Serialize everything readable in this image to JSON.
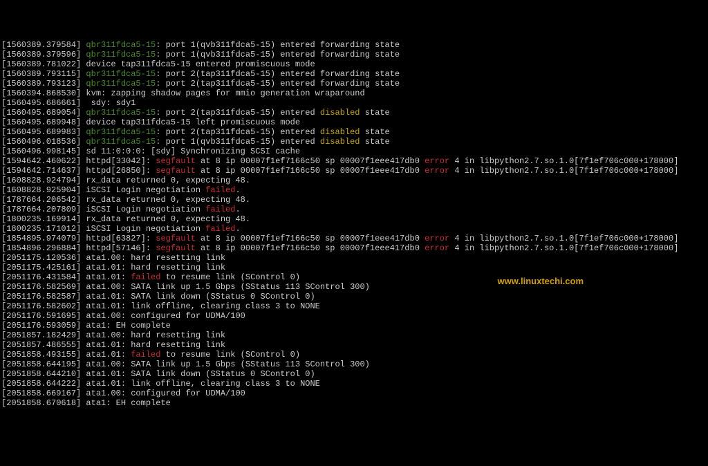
{
  "watermark": "www.linuxtechi.com",
  "lines": [
    {
      "ts": "[1560389.379584]",
      "parts": [
        {
          "c": "green",
          "t": " qbr311fdca5-15"
        },
        {
          "c": "txt",
          "t": ": port 1(qvb311fdca5-15) entered forwarding state"
        }
      ]
    },
    {
      "ts": "[1560389.379596]",
      "parts": [
        {
          "c": "green",
          "t": " qbr311fdca5-15"
        },
        {
          "c": "txt",
          "t": ": port 1(qvb311fdca5-15) entered forwarding state"
        }
      ]
    },
    {
      "ts": "[1560389.781022]",
      "parts": [
        {
          "c": "txt",
          "t": " device tap311fdca5-15 entered promiscuous mode"
        }
      ]
    },
    {
      "ts": "[1560389.793115]",
      "parts": [
        {
          "c": "green",
          "t": " qbr311fdca5-15"
        },
        {
          "c": "txt",
          "t": ": port 2(tap311fdca5-15) entered forwarding state"
        }
      ]
    },
    {
      "ts": "[1560389.793123]",
      "parts": [
        {
          "c": "green",
          "t": " qbr311fdca5-15"
        },
        {
          "c": "txt",
          "t": ": port 2(tap311fdca5-15) entered forwarding state"
        }
      ]
    },
    {
      "ts": "[1560394.868530]",
      "parts": [
        {
          "c": "txt",
          "t": " kvm: zapping shadow pages for mmio generation wraparound"
        }
      ]
    },
    {
      "ts": "[1560495.686661]",
      "parts": [
        {
          "c": "txt",
          "t": "  sdy: sdy1"
        }
      ]
    },
    {
      "ts": "[1560495.689054]",
      "parts": [
        {
          "c": "green",
          "t": " qbr311fdca5-15"
        },
        {
          "c": "txt",
          "t": ": port 2(tap311fdca5-15) entered "
        },
        {
          "c": "yellow",
          "t": "disabled"
        },
        {
          "c": "txt",
          "t": " state"
        }
      ]
    },
    {
      "ts": "[1560495.689948]",
      "parts": [
        {
          "c": "txt",
          "t": " device tap311fdca5-15 left promiscuous mode"
        }
      ]
    },
    {
      "ts": "[1560495.689983]",
      "parts": [
        {
          "c": "green",
          "t": " qbr311fdca5-15"
        },
        {
          "c": "txt",
          "t": ": port 2(tap311fdca5-15) entered "
        },
        {
          "c": "yellow",
          "t": "disabled"
        },
        {
          "c": "txt",
          "t": " state"
        }
      ]
    },
    {
      "ts": "[1560496.018536]",
      "parts": [
        {
          "c": "green",
          "t": " qbr311fdca5-15"
        },
        {
          "c": "txt",
          "t": ": port 1(qvb311fdca5-15) entered "
        },
        {
          "c": "yellow",
          "t": "disabled"
        },
        {
          "c": "txt",
          "t": " state"
        }
      ]
    },
    {
      "ts": "[1560496.998145]",
      "parts": [
        {
          "c": "txt",
          "t": " sd 11:0:0:0: [sdy] Synchronizing SCSI cache"
        }
      ]
    },
    {
      "ts": "[1594642.460622]",
      "parts": [
        {
          "c": "txt",
          "t": " httpd[33042]: "
        },
        {
          "c": "red",
          "t": "segfault"
        },
        {
          "c": "txt",
          "t": " at 8 ip 00007f1ef7166c50 sp 00007f1eee417db0 "
        },
        {
          "c": "red",
          "t": "error"
        },
        {
          "c": "txt",
          "t": " 4 in libpython2.7.so.1.0[7f1ef706c000+178000]"
        }
      ]
    },
    {
      "ts": "[1594642.714637]",
      "parts": [
        {
          "c": "txt",
          "t": " httpd[26850]: "
        },
        {
          "c": "red",
          "t": "segfault"
        },
        {
          "c": "txt",
          "t": " at 8 ip 00007f1ef7166c50 sp 00007f1eee417db0 "
        },
        {
          "c": "red",
          "t": "error"
        },
        {
          "c": "txt",
          "t": " 4 in libpython2.7.so.1.0[7f1ef706c000+178000]"
        }
      ]
    },
    {
      "ts": "[1608828.924794]",
      "parts": [
        {
          "c": "txt",
          "t": " rx_data returned 0, expecting 48."
        }
      ]
    },
    {
      "ts": "[1608828.925904]",
      "parts": [
        {
          "c": "txt",
          "t": " iSCSI Login negotiation "
        },
        {
          "c": "red",
          "t": "failed"
        },
        {
          "c": "txt",
          "t": "."
        }
      ]
    },
    {
      "ts": "[1787664.206542]",
      "parts": [
        {
          "c": "txt",
          "t": " rx_data returned 0, expecting 48."
        }
      ]
    },
    {
      "ts": "[1787664.207809]",
      "parts": [
        {
          "c": "txt",
          "t": " iSCSI Login negotiation "
        },
        {
          "c": "red",
          "t": "failed"
        },
        {
          "c": "txt",
          "t": "."
        }
      ]
    },
    {
      "ts": "[1800235.169914]",
      "parts": [
        {
          "c": "txt",
          "t": " rx_data returned 0, expecting 48."
        }
      ]
    },
    {
      "ts": "[1800235.171012]",
      "parts": [
        {
          "c": "txt",
          "t": " iSCSI Login negotiation "
        },
        {
          "c": "red",
          "t": "failed"
        },
        {
          "c": "txt",
          "t": "."
        }
      ]
    },
    {
      "ts": "[1854895.974079]",
      "parts": [
        {
          "c": "txt",
          "t": " httpd[63827]: "
        },
        {
          "c": "red",
          "t": "segfault"
        },
        {
          "c": "txt",
          "t": " at 8 ip 00007f1ef7166c50 sp 00007f1eee417db0 "
        },
        {
          "c": "red",
          "t": "error"
        },
        {
          "c": "txt",
          "t": " 4 in libpython2.7.so.1.0[7f1ef706c000+178000]"
        }
      ]
    },
    {
      "ts": "[1854896.296884]",
      "parts": [
        {
          "c": "txt",
          "t": " httpd[57146]: "
        },
        {
          "c": "red",
          "t": "segfault"
        },
        {
          "c": "txt",
          "t": " at 8 ip 00007f1ef7166c50 sp 00007f1eee417db0 "
        },
        {
          "c": "red",
          "t": "error"
        },
        {
          "c": "txt",
          "t": " 4 in libpython2.7.so.1.0[7f1ef706c000+178000]"
        }
      ]
    },
    {
      "ts": "[2051175.120536]",
      "parts": [
        {
          "c": "txt",
          "t": " ata1.00: hard resetting link"
        }
      ]
    },
    {
      "ts": "[2051175.425161]",
      "parts": [
        {
          "c": "txt",
          "t": " ata1.01: hard resetting link"
        }
      ]
    },
    {
      "ts": "[2051176.431584]",
      "parts": [
        {
          "c": "txt",
          "t": " ata1.01: "
        },
        {
          "c": "red",
          "t": "failed"
        },
        {
          "c": "txt",
          "t": " to resume link (SControl 0)"
        }
      ]
    },
    {
      "ts": "[2051176.582569]",
      "parts": [
        {
          "c": "txt",
          "t": " ata1.00: SATA link up 1.5 Gbps (SStatus 113 SControl 300)"
        }
      ]
    },
    {
      "ts": "[2051176.582587]",
      "parts": [
        {
          "c": "txt",
          "t": " ata1.01: SATA link down (SStatus 0 SControl 0)"
        }
      ]
    },
    {
      "ts": "[2051176.582602]",
      "parts": [
        {
          "c": "txt",
          "t": " ata1.01: link offline, clearing class 3 to NONE"
        }
      ]
    },
    {
      "ts": "[2051176.591695]",
      "parts": [
        {
          "c": "txt",
          "t": " ata1.00: configured for UDMA/100"
        }
      ]
    },
    {
      "ts": "[2051176.593059]",
      "parts": [
        {
          "c": "txt",
          "t": " ata1: EH complete"
        }
      ]
    },
    {
      "ts": "[2051857.182429]",
      "parts": [
        {
          "c": "txt",
          "t": " ata1.00: hard resetting link"
        }
      ]
    },
    {
      "ts": "[2051857.486555]",
      "parts": [
        {
          "c": "txt",
          "t": " ata1.01: hard resetting link"
        }
      ]
    },
    {
      "ts": "[2051858.493155]",
      "parts": [
        {
          "c": "txt",
          "t": " ata1.01: "
        },
        {
          "c": "red",
          "t": "failed"
        },
        {
          "c": "txt",
          "t": " to resume link (SControl 0)"
        }
      ]
    },
    {
      "ts": "[2051858.644195]",
      "parts": [
        {
          "c": "txt",
          "t": " ata1.00: SATA link up 1.5 Gbps (SStatus 113 SControl 300)"
        }
      ]
    },
    {
      "ts": "[2051858.644210]",
      "parts": [
        {
          "c": "txt",
          "t": " ata1.01: SATA link down (SStatus 0 SControl 0)"
        }
      ]
    },
    {
      "ts": "[2051858.644222]",
      "parts": [
        {
          "c": "txt",
          "t": " ata1.01: link offline, clearing class 3 to NONE"
        }
      ]
    },
    {
      "ts": "[2051858.669167]",
      "parts": [
        {
          "c": "txt",
          "t": " ata1.00: configured for UDMA/100"
        }
      ]
    },
    {
      "ts": "[2051858.670618]",
      "parts": [
        {
          "c": "txt",
          "t": " ata1: EH complete"
        }
      ]
    }
  ]
}
